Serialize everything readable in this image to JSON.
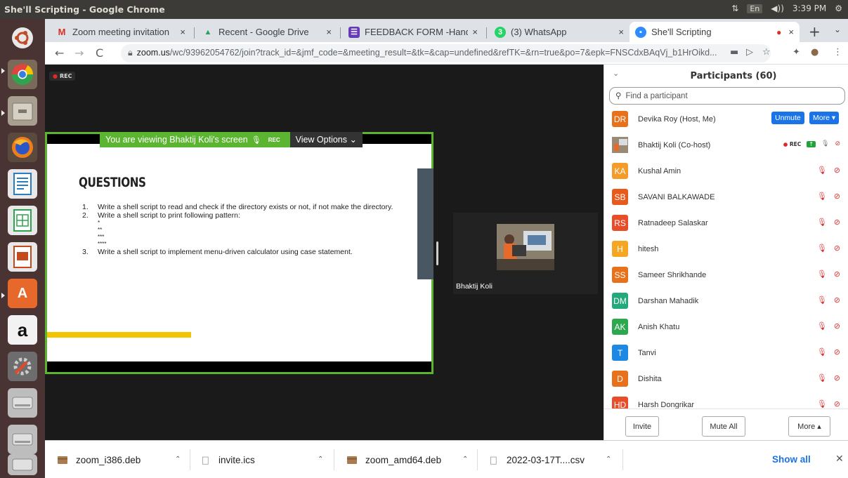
{
  "os": {
    "window_title": "She'll Scripting - Google Chrome",
    "tray": {
      "network": "⇅",
      "keyboard": "En",
      "volume": "◀))",
      "time": "3:39 PM",
      "settings": "⚙"
    }
  },
  "launcher": {
    "items": [
      {
        "name": "ubuntu-dash-icon",
        "color": "#e8e8e8"
      },
      {
        "name": "chrome-icon",
        "color": "#e0443e"
      },
      {
        "name": "files-icon",
        "color": "#b9b2a5"
      },
      {
        "name": "firefox-icon",
        "color": "#ef7d1a"
      },
      {
        "name": "writer-icon",
        "color": "#2a7ebf"
      },
      {
        "name": "calc-icon",
        "color": "#2ea44f"
      },
      {
        "name": "impress-icon",
        "color": "#c44a1d"
      },
      {
        "name": "software-center-icon",
        "color": "#e8682b"
      },
      {
        "name": "amazon-icon",
        "color": "#f2f2f2"
      },
      {
        "name": "system-settings-icon",
        "color": "#9aa0a6"
      },
      {
        "name": "drive-icon-1",
        "color": "#bdbdbd"
      },
      {
        "name": "drive-icon-2",
        "color": "#bdbdbd"
      },
      {
        "name": "drive-icon-3",
        "color": "#bdbdbd"
      }
    ]
  },
  "browser": {
    "tabs": [
      {
        "title": "Zoom meeting invitation",
        "icon": "gmail-icon",
        "icon_color": "#d93025",
        "icon_text": "M",
        "close": "×"
      },
      {
        "title": "Recent - Google Drive",
        "icon": "drive-icon",
        "icon_color": "#1fa463",
        "icon_text": "▲",
        "close": "×"
      },
      {
        "title": "FEEDBACK FORM -Hands",
        "icon": "forms-icon",
        "icon_color": "#673ab7",
        "icon_text": "☰",
        "close": "×"
      },
      {
        "title": "(3) WhatsApp",
        "icon": "whatsapp-icon",
        "icon_color": "#25d366",
        "icon_text": "3",
        "close": "×"
      },
      {
        "title": "She'll Scripting",
        "icon": "zoom-icon",
        "icon_color": "#2d8cff",
        "icon_text": "▪",
        "close": "×",
        "recording": "●"
      }
    ],
    "new_tab": "+",
    "tab_menu": "⌄",
    "nav": {
      "back": "←",
      "forward": "→",
      "reload": "C"
    },
    "url_host": "zoom.us",
    "url_path": "/wc/93962054762/join?track_id=&jmf_code=&meeting_result=&tk=&cap=undefined&refTK=&rn=true&po=7&epk=FNSCdxBAqVj_b1HrOikd...",
    "toolbar_icons": [
      "▬",
      "▷",
      "☆",
      "✦",
      "●",
      "⋮"
    ]
  },
  "zoom": {
    "rec_label": "REC",
    "share_banner": "You are viewing Bhaktij Koli's screen",
    "share_rec": "REC",
    "view_options": "View Options ⌄",
    "slide": {
      "title": "QUESTIONS",
      "items": [
        {
          "num": "1.",
          "text": "Write a shell script to read and check if the directory exists or not, if not make the directory."
        },
        {
          "num": "2.",
          "text": "Write a shell script to print following pattern:"
        },
        {
          "num": "3.",
          "text": "Write a shell script to implement menu-driven calculator using case statement."
        }
      ],
      "pattern": [
        "*",
        "**",
        "***",
        "****"
      ]
    },
    "video_name": "Bhaktij Koli"
  },
  "participants": {
    "title": "Participants (60)",
    "search_placeholder": "Find a participant",
    "unmute_label": "Unmute",
    "more_label": "More ▾",
    "list": [
      {
        "initials": "DR",
        "name": "Devika Roy (Host, Me)",
        "color": "#e8711c"
      },
      {
        "initials": "",
        "name": "Bhaktij Koli (Co-host)",
        "color": "#8a7a66"
      },
      {
        "initials": "KA",
        "name": "Kushal Amin",
        "color": "#f59b2a"
      },
      {
        "initials": "SB",
        "name": "SAVANI BALKAWADE",
        "color": "#e8591c"
      },
      {
        "initials": "RS",
        "name": "Ratnadeep Salaskar",
        "color": "#e84d2a"
      },
      {
        "initials": "H",
        "name": "hitesh",
        "color": "#f5a623"
      },
      {
        "initials": "SS",
        "name": "Sameer Shrikhande",
        "color": "#e8711c"
      },
      {
        "initials": "DM",
        "name": "Darshan Mahadik",
        "color": "#23a97a"
      },
      {
        "initials": "AK",
        "name": "Anish Khatu",
        "color": "#2ea84f"
      },
      {
        "initials": "T",
        "name": "Tanvi",
        "color": "#1e88e5"
      },
      {
        "initials": "D",
        "name": "Dishita",
        "color": "#e8711c"
      },
      {
        "initials": "HD",
        "name": "Harsh Dongrikar",
        "color": "#e84d2a"
      }
    ],
    "cohost_rec": "REC",
    "footer": {
      "invite": "Invite",
      "mute_all": "Mute All",
      "more": "More ▴"
    }
  },
  "downloads": {
    "items": [
      {
        "name": "zoom_i386.deb",
        "icon": "package-icon"
      },
      {
        "name": "invite.ics",
        "icon": "file-icon"
      },
      {
        "name": "zoom_amd64.deb",
        "icon": "package-icon"
      },
      {
        "name": "2022-03-17T....csv",
        "icon": "file-icon"
      }
    ],
    "chevron": "⌃",
    "show_all": "Show all",
    "close": "✕"
  }
}
